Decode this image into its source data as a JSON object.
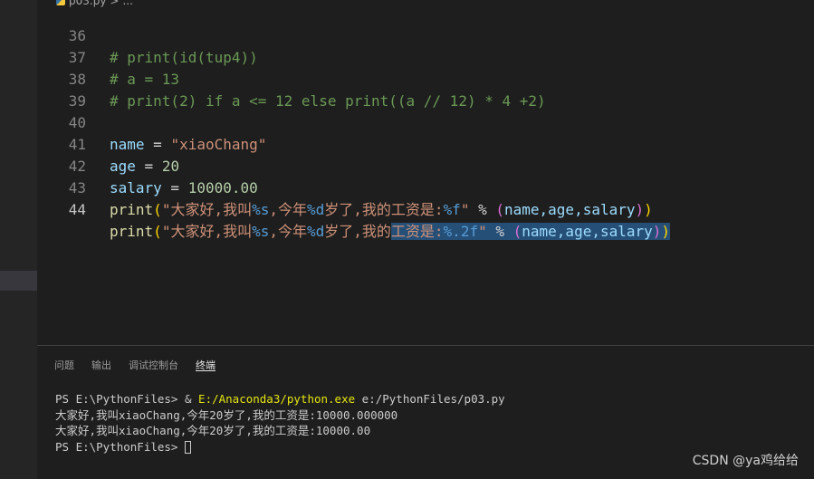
{
  "breadcrumb": {
    "file": "p03.py",
    "sep": ">",
    "more": "..."
  },
  "editor": {
    "lines": [
      {
        "num": "36",
        "text": "# print(id(tup4))"
      },
      {
        "num": "37",
        "text": "# a = 13"
      },
      {
        "num": "38",
        "text": "# print(2) if a <= 12 else print((a // 12) * 4 +2)"
      },
      {
        "num": "39",
        "text": ""
      },
      {
        "num": "40",
        "var": "name",
        "eq": " = ",
        "val": "\"xiaoChang\""
      },
      {
        "num": "41",
        "var": "age",
        "eq": " = ",
        "val": "20"
      },
      {
        "num": "42",
        "var": "salary",
        "eq": " = ",
        "val": "10000.00"
      },
      {
        "num": "43",
        "fn": "print",
        "s1": "\"大家好,我叫",
        "f1": "%s",
        "s2": ",今年",
        "f2": "%d",
        "s3": "岁了,我的工资是:",
        "f3": "%f",
        "s4": "\"",
        "pct": " % ",
        "args": "name,age,salary"
      },
      {
        "num": "44",
        "fn": "print",
        "s1": "\"大家好,我叫",
        "f1": "%s",
        "s2": ",今年",
        "f2": "%d",
        "s3a": "岁了,我的",
        "s3b": "工资是:",
        "f3": "%.2f",
        "s4": "\"",
        "pct": " % ",
        "args": "name,age,salary"
      }
    ],
    "active_line": "44"
  },
  "panel": {
    "tabs": [
      "问题",
      "输出",
      "调试控制台",
      "终端"
    ],
    "active_tab": "终端",
    "terminal": {
      "line1_prompt": "PS E:\\PythonFiles> & ",
      "line1_exe": "E:/Anaconda3/python.exe",
      "line1_rest": " e:/PythonFiles/p03.py",
      "line2": "大家好,我叫xiaoChang,今年20岁了,我的工资是:10000.000000",
      "line3": "大家好,我叫xiaoChang,今年20岁了,我的工资是:10000.00",
      "line4_prompt": "PS E:\\PythonFiles> "
    }
  },
  "watermark": "CSDN @ya鸡给给",
  "colors": {
    "background": "#1e1e1e",
    "comment": "#6a9955",
    "variable": "#9cdcfe",
    "string": "#ce9178",
    "number": "#b5cea8",
    "function": "#dcdcaa",
    "selection": "#264f78"
  }
}
